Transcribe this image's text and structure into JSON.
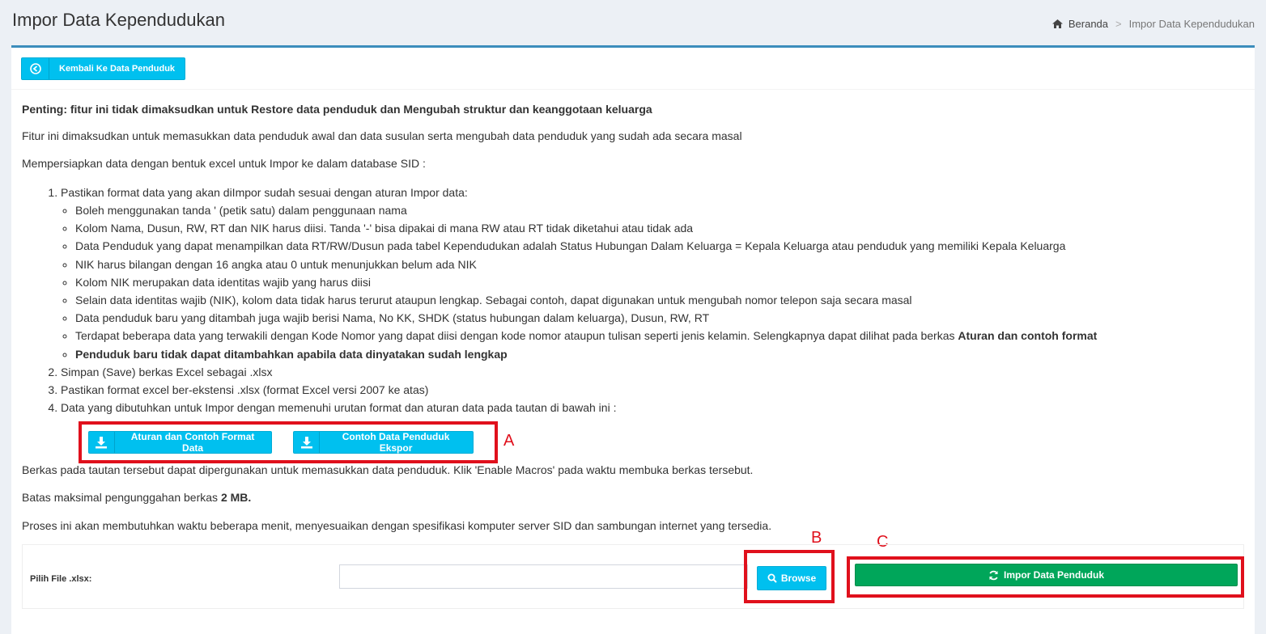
{
  "header": {
    "title": "Impor Data Kependudukan"
  },
  "breadcrumb": {
    "home": "Beranda",
    "separator": ">",
    "current": "Impor Data Kependudukan"
  },
  "toolbar": {
    "back_label": "Kembali Ke Data Penduduk"
  },
  "content": {
    "important": "Penting: fitur ini tidak dimaksudkan untuk Restore data penduduk dan Mengubah struktur dan keanggotaan keluarga",
    "intro": "Fitur ini dimaksudkan untuk memasukkan data penduduk awal dan data susulan serta mengubah data penduduk yang sudah ada secara masal",
    "prepare": "Mempersiapkan data dengan bentuk excel untuk Impor ke dalam database SID :",
    "step1": "Pastikan format data yang akan diImpor sudah sesuai dengan aturan Impor data:",
    "rules": [
      "Boleh menggunakan tanda ' (petik satu) dalam penggunaan nama",
      "Kolom Nama, Dusun, RW, RT dan NIK harus diisi. Tanda '-' bisa dipakai di mana RW atau RT tidak diketahui atau tidak ada",
      "Data Penduduk yang dapat menampilkan data RT/RW/Dusun pada tabel Kependudukan adalah Status Hubungan Dalam Keluarga = Kepala Keluarga atau penduduk yang memiliki Kepala Keluarga",
      "NIK harus bilangan dengan 16 angka atau 0 untuk menunjukkan belum ada NIK",
      "Kolom NIK merupakan data identitas wajib yang harus diisi",
      "Selain data identitas wajib (NIK), kolom data tidak harus terurut ataupun lengkap. Sebagai contoh, dapat digunakan untuk mengubah nomor telepon saja secara masal",
      "Data penduduk baru yang ditambah juga wajib berisi Nama, No KK, SHDK (status hubungan dalam keluarga), Dusun, RW, RT"
    ],
    "rule8_prefix": "Terdapat beberapa data yang terwakili dengan Kode Nomor yang dapat diisi dengan kode nomor ataupun tulisan seperti jenis kelamin. Selengkapnya dapat dilihat pada berkas ",
    "rule8_bold": "Aturan dan contoh format",
    "rule9": "Penduduk baru tidak dapat ditambahkan apabila data dinyatakan sudah lengkap",
    "step2": "Simpan (Save) berkas Excel sebagai .xlsx",
    "step3": "Pastikan format excel ber-ekstensi .xlsx (format Excel versi 2007 ke atas)",
    "step4": "Data yang dibutuhkan untuk Impor dengan memenuhi urutan format dan aturan data pada tautan di bawah ini :",
    "download_format": "Aturan dan Contoh Format Data",
    "download_export": "Contoh Data Penduduk Ekspor",
    "note_macros": "Berkas pada tautan tersebut dapat dipergunakan untuk memasukkan data penduduk. Klik 'Enable Macros' pada waktu membuka berkas tersebut.",
    "limit_prefix": "Batas maksimal pengunggahan berkas ",
    "limit_value": "2 MB.",
    "process_note": "Proses ini akan membutuhkan waktu beberapa menit, menyesuaikan dengan spesifikasi komputer server SID dan sambungan internet yang tersedia."
  },
  "markers": {
    "a": "A",
    "b": "B",
    "c": "C"
  },
  "upload": {
    "label": "Pilih File .xlsx:",
    "file_value": "",
    "browse_label": "Browse",
    "submit_label": "Impor Data Penduduk"
  },
  "colors": {
    "info": "#00c0ef",
    "success": "#00a65a",
    "primary": "#3c8dbc",
    "annotation": "#e0101c"
  }
}
